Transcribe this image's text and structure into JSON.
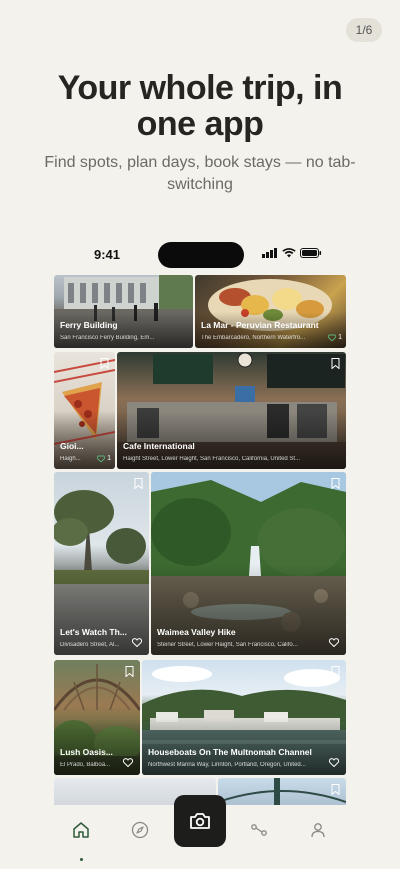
{
  "onboarding": {
    "page_indicator": "1/6",
    "headline": "Your whole trip, in one app",
    "subline": "Find spots, plan days, book stays — no tab-switching"
  },
  "status_bar": {
    "time": "9:41"
  },
  "feed": {
    "cards": [
      {
        "title": "Ferry Building",
        "subtitle": "San Francisco Ferry Building, Em...",
        "likes": ""
      },
      {
        "title": "La Mar - Peruvian Restaurant",
        "subtitle": "The Embarcadero, Northern Waterfro...",
        "likes": "1"
      },
      {
        "title": "Gioi...",
        "subtitle": "Haigh...",
        "likes": "1"
      },
      {
        "title": "Cafe International",
        "subtitle": "Haight Street, Lower Haight, San Francisco, California, United St...",
        "likes": ""
      },
      {
        "title": "Let's Watch Th...",
        "subtitle": "Divisadero Street, Al...",
        "likes": ""
      },
      {
        "title": "Waimea Valley Hike",
        "subtitle": "Steiner Street, Lower Haight, San Francisco, Califo...",
        "likes": ""
      },
      {
        "title": "Lush Oasis...",
        "subtitle": "El Prado, Balboa...",
        "likes": ""
      },
      {
        "title": "Houseboats On The Multnomah Channel",
        "subtitle": "Northwest Marina Way, Linnton, Portland, Oregon, United...",
        "likes": ""
      }
    ]
  },
  "tabbar": {
    "items": [
      "home",
      "explore",
      "camera",
      "routes",
      "profile"
    ]
  },
  "colors": {
    "background": "#f4f2ec",
    "accent": "#2f5a3a",
    "camera_button": "#1d1d1b",
    "headline": "#262522"
  }
}
